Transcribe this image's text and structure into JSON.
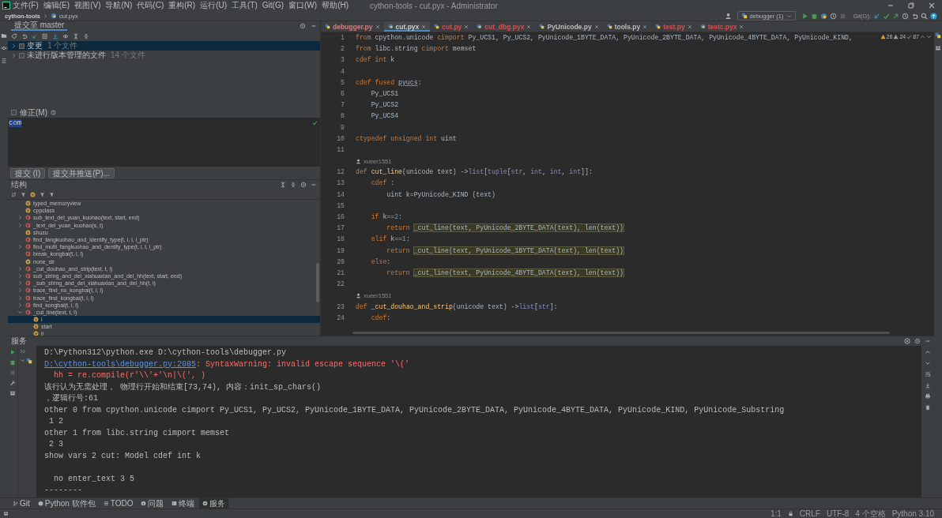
{
  "menu_bar": {
    "items": [
      "文件(F)",
      "编辑(E)",
      "视图(V)",
      "导航(N)",
      "代码(C)",
      "重构(R)",
      "运行(U)",
      "工具(T)",
      "Git(G)",
      "窗口(W)",
      "帮助(H)"
    ],
    "title": "cython-tools - cut.pyx - Administrator"
  },
  "navigation_bar": {
    "project": "cython-tools",
    "file": "cut.pyx",
    "run_config": "debugger (1)",
    "git_label": "Git(G):"
  },
  "commit_panel": {
    "tab": "提交至 master",
    "changes": [
      {
        "label": "变更",
        "count": "1 个文件",
        "selected": true,
        "checked": false,
        "expanded": false
      },
      {
        "label": "未进行版本管理的文件",
        "count": "14 个文件",
        "selected": false,
        "checked": false,
        "expanded": false
      }
    ],
    "amend": {
      "label": "修正(M)",
      "checked": false
    },
    "message": "com",
    "buttons": [
      "提交 (I)",
      "提交并推送(P)..."
    ]
  },
  "structure_panel": {
    "title": "结构",
    "items": [
      {
        "name": "typed_memoryview",
        "kind": "variable",
        "selected": false
      },
      {
        "name": "cppclass",
        "kind": "variable",
        "selected": false
      },
      {
        "name": "sub_text_del_yuan_kuohao(text, start, end)",
        "kind": "function",
        "selected": false,
        "expanded": false
      },
      {
        "name": "_text_del_yuan_kuohao(s, t)",
        "kind": "function",
        "selected": false,
        "expanded": false
      },
      {
        "name": "shuzu",
        "kind": "variable",
        "selected": false
      },
      {
        "name": "find_fangkuohao_and_identify_type(t, i, l, i_ptr)",
        "kind": "function",
        "selected": false
      },
      {
        "name": "find_multi_fangkuohao_and_dentify_type(t, i, l, i_ptr)",
        "kind": "function",
        "selected": false,
        "expanded": false
      },
      {
        "name": "break_kongbai(t, i, l)",
        "kind": "function",
        "selected": false
      },
      {
        "name": "none_str",
        "kind": "variable",
        "selected": false
      },
      {
        "name": "_cut_douhao_and_strip(text, t, l)",
        "kind": "function",
        "selected": false,
        "expanded": false
      },
      {
        "name": "sub_string_and_del_xiahuaxian_and_del_hh(text, start, end)",
        "kind": "function",
        "selected": false,
        "expanded": false
      },
      {
        "name": "_sub_string_and_del_xiahuaxian_and_del_hh(t, l)",
        "kind": "function",
        "selected": false,
        "expanded": false
      },
      {
        "name": "trace_find_no_kongbai(t, i, l)",
        "kind": "function",
        "selected": false,
        "expanded": false
      },
      {
        "name": "trace_find_kongbai(t, i, l)",
        "kind": "function",
        "selected": false,
        "expanded": false
      },
      {
        "name": "find_kongbai(t, i, l)",
        "kind": "function",
        "selected": false,
        "expanded": false
      },
      {
        "name": "_cut_line(text, t, l)",
        "kind": "function",
        "selected": false,
        "expanded": true,
        "children": [
          {
            "name": "i",
            "kind": "variable",
            "selected": true
          },
          {
            "name": "start",
            "kind": "variable",
            "selected": false
          },
          {
            "name": "ii",
            "kind": "variable",
            "selected": false
          }
        ]
      }
    ]
  },
  "editor": {
    "tabs": [
      {
        "label": "debugger.py",
        "selected": false,
        "color": "#d27f7f"
      },
      {
        "label": "cut.pyx",
        "selected": true,
        "color": "#d0d0d0"
      },
      {
        "label": "cut.py",
        "selected": false,
        "color": "#d25252"
      },
      {
        "label": "cut_dbg.pyx",
        "selected": false,
        "color": "#d25252"
      },
      {
        "label": "PyUnicode.py",
        "selected": false,
        "color": "#bbbbbb"
      },
      {
        "label": "tools.py",
        "selected": false,
        "color": "#bbbbbb"
      },
      {
        "label": "test.py",
        "selected": false,
        "color": "#d25252"
      },
      {
        "label": "testc.pyx",
        "selected": false,
        "color": "#d25252"
      }
    ],
    "inspections": {
      "warnings": "28",
      "weak_warnings": "24",
      "passed": "87"
    },
    "lines": [
      {
        "number": "1",
        "tokens": [
          {
            "kind": "keyword",
            "text": "from"
          },
          {
            "kind": "plain",
            "text": " cpython.unicode "
          },
          {
            "kind": "keyword",
            "text": "cimport"
          },
          {
            "kind": "plain",
            "text": " Py_UCS1, Py_UCS2, PyUnicode_1BYTE_DATA, PyUnicode_2BYTE_DATA, PyUnicode_4BYTE_DATA, PyUnicode_KIND,"
          }
        ]
      },
      {
        "number": "2",
        "tokens": [
          {
            "kind": "keyword",
            "text": "from"
          },
          {
            "kind": "plain",
            "text": " libc.string "
          },
          {
            "kind": "keyword",
            "text": "cimport"
          },
          {
            "kind": "plain",
            "text": " memset"
          }
        ]
      },
      {
        "number": "3",
        "tokens": [
          {
            "kind": "keyword",
            "text": "cdef int"
          },
          {
            "kind": "plain",
            "text": " k"
          }
        ]
      },
      {
        "number": "4"
      },
      {
        "number": "5",
        "tokens": [
          {
            "kind": "keyword",
            "text": "cdef fused "
          },
          {
            "kind": "underlined",
            "text": "pyucs"
          },
          {
            "kind": "plain",
            "text": ":"
          }
        ]
      },
      {
        "number": "6",
        "tokens": [
          {
            "kind": "plain",
            "text": "    Py_UCS1"
          }
        ]
      },
      {
        "number": "7",
        "tokens": [
          {
            "kind": "plain",
            "text": "    Py_UCS2"
          }
        ]
      },
      {
        "number": "8",
        "tokens": [
          {
            "kind": "plain",
            "text": "    Py_UCS4"
          }
        ]
      },
      {
        "number": "9"
      },
      {
        "number": "10",
        "tokens": [
          {
            "kind": "keyword",
            "text": "ctypedef unsigned int"
          },
          {
            "kind": "plain",
            "text": " uint"
          }
        ]
      },
      {
        "number": "11"
      },
      {
        "author": "xueer1551"
      },
      {
        "number": "12",
        "tokens": [
          {
            "kind": "keyword",
            "text": "def "
          },
          {
            "kind": "function",
            "text": "cut_line"
          },
          {
            "kind": "plain",
            "text": "(unicode text) ->"
          },
          {
            "kind": "builtin",
            "text": "list"
          },
          {
            "kind": "plain",
            "text": "["
          },
          {
            "kind": "builtin",
            "text": "tuple"
          },
          {
            "kind": "plain",
            "text": "["
          },
          {
            "kind": "builtin",
            "text": "str"
          },
          {
            "kind": "plain",
            "text": ", "
          },
          {
            "kind": "builtin",
            "text": "int"
          },
          {
            "kind": "plain",
            "text": ", "
          },
          {
            "kind": "builtin",
            "text": "int"
          },
          {
            "kind": "plain",
            "text": ", "
          },
          {
            "kind": "builtin",
            "text": "int"
          },
          {
            "kind": "plain",
            "text": "]]:"
          }
        ]
      },
      {
        "number": "13",
        "tokens": [
          {
            "kind": "keyword",
            "text": "    cdef"
          },
          {
            "kind": "plain",
            "text": " :"
          }
        ]
      },
      {
        "number": "14",
        "tokens": [
          {
            "kind": "plain",
            "text": "        uint k=PyUnicode_KIND (text)"
          }
        ]
      },
      {
        "number": "15"
      },
      {
        "number": "16",
        "tokens": [
          {
            "kind": "keyword",
            "text": "    if"
          },
          {
            "kind": "plain",
            "text": " k=="
          },
          {
            "kind": "number",
            "text": "2"
          },
          {
            "kind": "plain",
            "text": ":"
          }
        ]
      },
      {
        "number": "17",
        "tokens": [
          {
            "kind": "keyword",
            "text": "        return "
          },
          {
            "kind": "highlight",
            "text": "_cut_line(text, PyUnicode_2BYTE_DATA(text), len(text))"
          }
        ]
      },
      {
        "number": "18",
        "tokens": [
          {
            "kind": "keyword",
            "text": "    elif"
          },
          {
            "kind": "plain",
            "text": " k=="
          },
          {
            "kind": "number",
            "text": "1"
          },
          {
            "kind": "plain",
            "text": ":"
          }
        ]
      },
      {
        "number": "19",
        "tokens": [
          {
            "kind": "keyword",
            "text": "        return "
          },
          {
            "kind": "highlight",
            "text": "_cut_line(text, PyUnicode_1BYTE_DATA(text), len(text))"
          }
        ]
      },
      {
        "number": "20",
        "tokens": [
          {
            "kind": "keyword",
            "text": "    else"
          },
          {
            "kind": "plain",
            "text": ":"
          }
        ]
      },
      {
        "number": "21",
        "tokens": [
          {
            "kind": "keyword",
            "text": "        return "
          },
          {
            "kind": "highlight",
            "text": "_cut_line(text, PyUnicode_4BYTE_DATA(text), len(text))"
          }
        ]
      },
      {
        "number": "22"
      },
      {
        "author": "xueer1551"
      },
      {
        "number": "23",
        "tokens": [
          {
            "kind": "keyword",
            "text": "def "
          },
          {
            "kind": "function",
            "text": "_cut_douhao_and_strip"
          },
          {
            "kind": "plain",
            "text": "(unicode text) ->"
          },
          {
            "kind": "builtin",
            "text": "list"
          },
          {
            "kind": "plain",
            "text": "["
          },
          {
            "kind": "builtin",
            "text": "str"
          },
          {
            "kind": "plain",
            "text": "]:"
          }
        ]
      },
      {
        "number": "24",
        "tokens": [
          {
            "kind": "keyword",
            "text": "    cdef"
          },
          {
            "kind": "plain",
            "text": ":"
          }
        ]
      }
    ]
  },
  "services_panel": {
    "title": "服务",
    "output": [
      [
        {
          "kind": "plain",
          "text": "D:\\Python312\\python.exe D:\\cython-tools\\debugger.py"
        }
      ],
      [
        {
          "kind": "link",
          "text": "D:\\cython-tools\\debugger.py:2085"
        },
        {
          "kind": "error",
          "text": ": SyntaxWarning: invalid escape sequence '\\('"
        }
      ],
      [
        {
          "kind": "error",
          "text": "  hh = re.compile(r'\\\\'+'\\n|\\(', )"
        }
      ],
      [
        {
          "kind": "plain",
          "text": "该行认为无需处理， 物理行开始和结束[73,74), 内容：init_sp_chars()"
        }
      ],
      [
        {
          "kind": "plain",
          "text": "，逻辑行号:61"
        }
      ],
      [
        {
          "kind": "plain",
          "text": "other 0 from cpython.unicode cimport Py_UCS1, Py_UCS2, PyUnicode_1BYTE_DATA, PyUnicode_2BYTE_DATA, PyUnicode_4BYTE_DATA, PyUnicode_KIND, PyUnicode_Substring"
        }
      ],
      [
        {
          "kind": "plain",
          "text": " 1 2"
        }
      ],
      [
        {
          "kind": "plain",
          "text": "other 1 from libc.string cimport memset"
        }
      ],
      [
        {
          "kind": "plain",
          "text": " 2 3"
        }
      ],
      [
        {
          "kind": "plain",
          "text": "show vars 2 cut: Model cdef int k"
        }
      ],
      [
        {
          "kind": "blank"
        }
      ],
      [
        {
          "kind": "plain",
          "text": "  no enter_text 3 5"
        }
      ],
      [
        {
          "kind": "plain",
          "text": "--------"
        }
      ]
    ]
  },
  "tool_window_bar": [
    {
      "label": "Git",
      "kind": "git",
      "selected": false
    },
    {
      "label": "Python 软件包",
      "kind": "packages",
      "selected": false
    },
    {
      "label": "TODO",
      "kind": "todo",
      "selected": false
    },
    {
      "label": "问题",
      "kind": "problems",
      "selected": false
    },
    {
      "label": "终端",
      "kind": "terminal",
      "selected": false
    },
    {
      "label": "服务",
      "kind": "services",
      "selected": true
    }
  ],
  "status_bar": {
    "position": "1:1",
    "line_separator": "CRLF",
    "encoding": "UTF-8",
    "indent": "4 个空格",
    "interpreter": "Python 3.10"
  }
}
